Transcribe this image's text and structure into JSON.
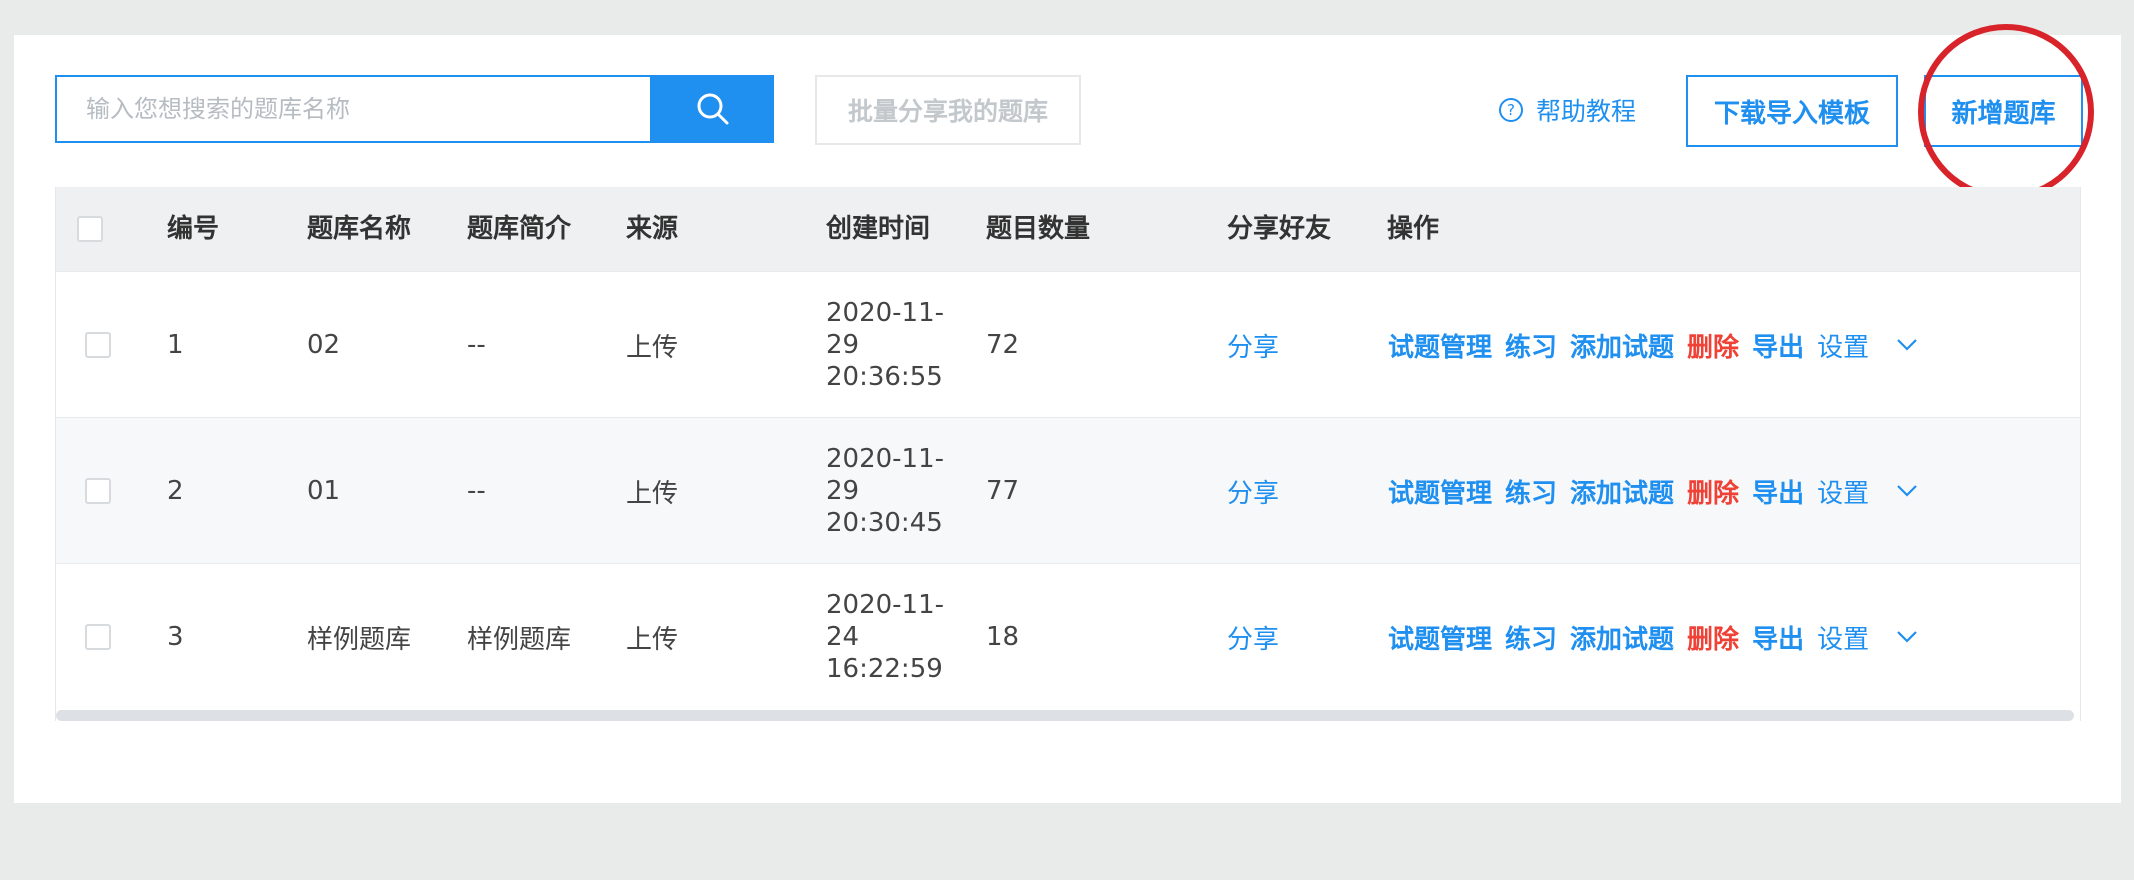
{
  "search": {
    "placeholder": "输入您想搜索的题库名称",
    "value": ""
  },
  "toolbar": {
    "batch_share_label": "批量分享我的题库",
    "help_label": "帮助教程",
    "help_icon_glyph": "?",
    "download_template_label": "下载导入模板",
    "new_bank_label": "新增题库"
  },
  "table": {
    "headers": {
      "id": "编号",
      "name": "题库名称",
      "intro": "题库简介",
      "source": "来源",
      "created": "创建时间",
      "count": "题目数量",
      "share": "分享好友",
      "actions": "操作"
    },
    "rows": [
      {
        "id": "1",
        "name": "02",
        "intro": "--",
        "source": "上传",
        "created": "2020-11-29 20:36:55",
        "count": "72",
        "share": "分享"
      },
      {
        "id": "2",
        "name": "01",
        "intro": "--",
        "source": "上传",
        "created": "2020-11-29 20:30:45",
        "count": "77",
        "share": "分享"
      },
      {
        "id": "3",
        "name": "样例题库",
        "intro": "样例题库",
        "source": "上传",
        "created": "2020-11-24 16:22:59",
        "count": "18",
        "share": "分享"
      }
    ],
    "action_labels": {
      "manage": "试题管理",
      "practice": "练习",
      "add": "添加试题",
      "delete": "删除",
      "export": "导出",
      "settings": "设置"
    }
  },
  "colors": {
    "accent": "#1f8ff0",
    "danger": "#ef4135",
    "annotation": "#d8232a"
  },
  "icons": {
    "search": "search-icon",
    "help": "question-circle-icon",
    "more": "chevron-down-icon"
  }
}
